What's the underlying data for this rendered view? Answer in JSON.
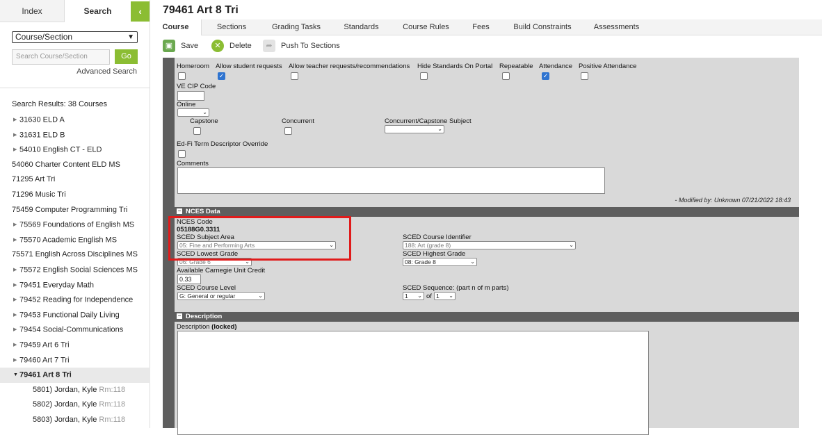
{
  "sidebar": {
    "tabs": {
      "index": "Index",
      "search": "Search"
    },
    "collapse_icon": "chevron-left-icon",
    "scope_select": "Course/Section",
    "search_placeholder": "Search Course/Section",
    "go_label": "Go",
    "advanced_search": "Advanced Search",
    "results_header": "Search Results: 38 Courses",
    "results": [
      {
        "label": "31630 ELD A",
        "expandable": true
      },
      {
        "label": "31631 ELD B",
        "expandable": true
      },
      {
        "label": "54010 English CT - ELD",
        "expandable": true
      },
      {
        "label": "54060 Charter Content ELD MS",
        "expandable": false
      },
      {
        "label": "71295 Art Tri",
        "expandable": false
      },
      {
        "label": "71296 Music Tri",
        "expandable": false
      },
      {
        "label": "75459 Computer Programming Tri",
        "expandable": false
      },
      {
        "label": "75569 Foundations of English MS",
        "expandable": true
      },
      {
        "label": "75570 Academic English MS",
        "expandable": true
      },
      {
        "label": "75571 English Across Disciplines MS",
        "expandable": false
      },
      {
        "label": "75572 English Social Sciences MS",
        "expandable": true
      },
      {
        "label": "79451 Everyday Math",
        "expandable": true
      },
      {
        "label": "79452 Reading for Independence",
        "expandable": true
      },
      {
        "label": "79453 Functional Daily Living",
        "expandable": true
      },
      {
        "label": "79454 Social-Communications",
        "expandable": true
      },
      {
        "label": "79459 Art 6 Tri",
        "expandable": true
      },
      {
        "label": "79460 Art 7 Tri",
        "expandable": true
      },
      {
        "label": "79461 Art 8 Tri",
        "expandable": true,
        "expanded": true,
        "selected": true
      }
    ],
    "sections": [
      {
        "label": "5801) Jordan, Kyle",
        "room": "Rm:118"
      },
      {
        "label": "5802) Jordan, Kyle",
        "room": "Rm:118"
      },
      {
        "label": "5803) Jordan, Kyle",
        "room": "Rm:118"
      }
    ]
  },
  "main": {
    "title": "79461 Art 8 Tri",
    "tabs": [
      "Course",
      "Sections",
      "Grading Tasks",
      "Standards",
      "Course Rules",
      "Fees",
      "Build Constraints",
      "Assessments"
    ],
    "active_tab": "Course",
    "toolbar": {
      "save": "Save",
      "delete": "Delete",
      "push": "Push To Sections"
    },
    "checkbox_labels": {
      "homeroom": "Homeroom",
      "allow_student": "Allow student requests",
      "allow_teacher": "Allow teacher requests/recommendations",
      "hide_standards": "Hide Standards On Portal",
      "repeatable": "Repeatable",
      "attendance": "Attendance",
      "positive_attendance": "Positive Attendance"
    },
    "checked": {
      "homeroom": false,
      "allow_student": true,
      "allow_teacher": false,
      "hide_standards": false,
      "repeatable": false,
      "attendance": true,
      "positive_attendance": false
    },
    "ve_cip_code_label": "VE CIP Code",
    "online_label": "Online",
    "capstone_label": "Capstone",
    "concurrent_label": "Concurrent",
    "concurrent_capstone_label": "Concurrent/Capstone Subject",
    "edfi_label": "Ed-Fi Term Descriptor Override",
    "comments_label": "Comments",
    "modified": "- Modified by: Unknown 07/21/2022 18:43",
    "nces": {
      "header": "NCES Data",
      "code_label": "NCES Code",
      "code_value": "05188G0.3311",
      "subject_area_label": "SCED Subject Area",
      "subject_area_value": "05: Fine and Performing Arts",
      "course_id_label": "SCED Course Identifier",
      "course_id_value": "188: Art (grade 8)",
      "lowest_label": "SCED Lowest Grade",
      "lowest_value": "06: Grade 6",
      "highest_label": "SCED Highest Grade",
      "highest_value": "08: Grade 8",
      "credit_label": "Available Carnegie Unit Credit",
      "credit_value": "0.33",
      "level_label": "SCED Course Level",
      "level_value": "G: General or regular",
      "sequence_label": "SCED Sequence: (part n of m parts)",
      "seq_n": "1",
      "seq_of": "of",
      "seq_m": "1"
    },
    "description": {
      "header": "Description",
      "label": "Description",
      "locked": "(locked)"
    }
  },
  "colors": {
    "accent_green": "#8bbd33",
    "section_bar": "#5e5e5e",
    "highlight_red": "#e01b1b"
  }
}
